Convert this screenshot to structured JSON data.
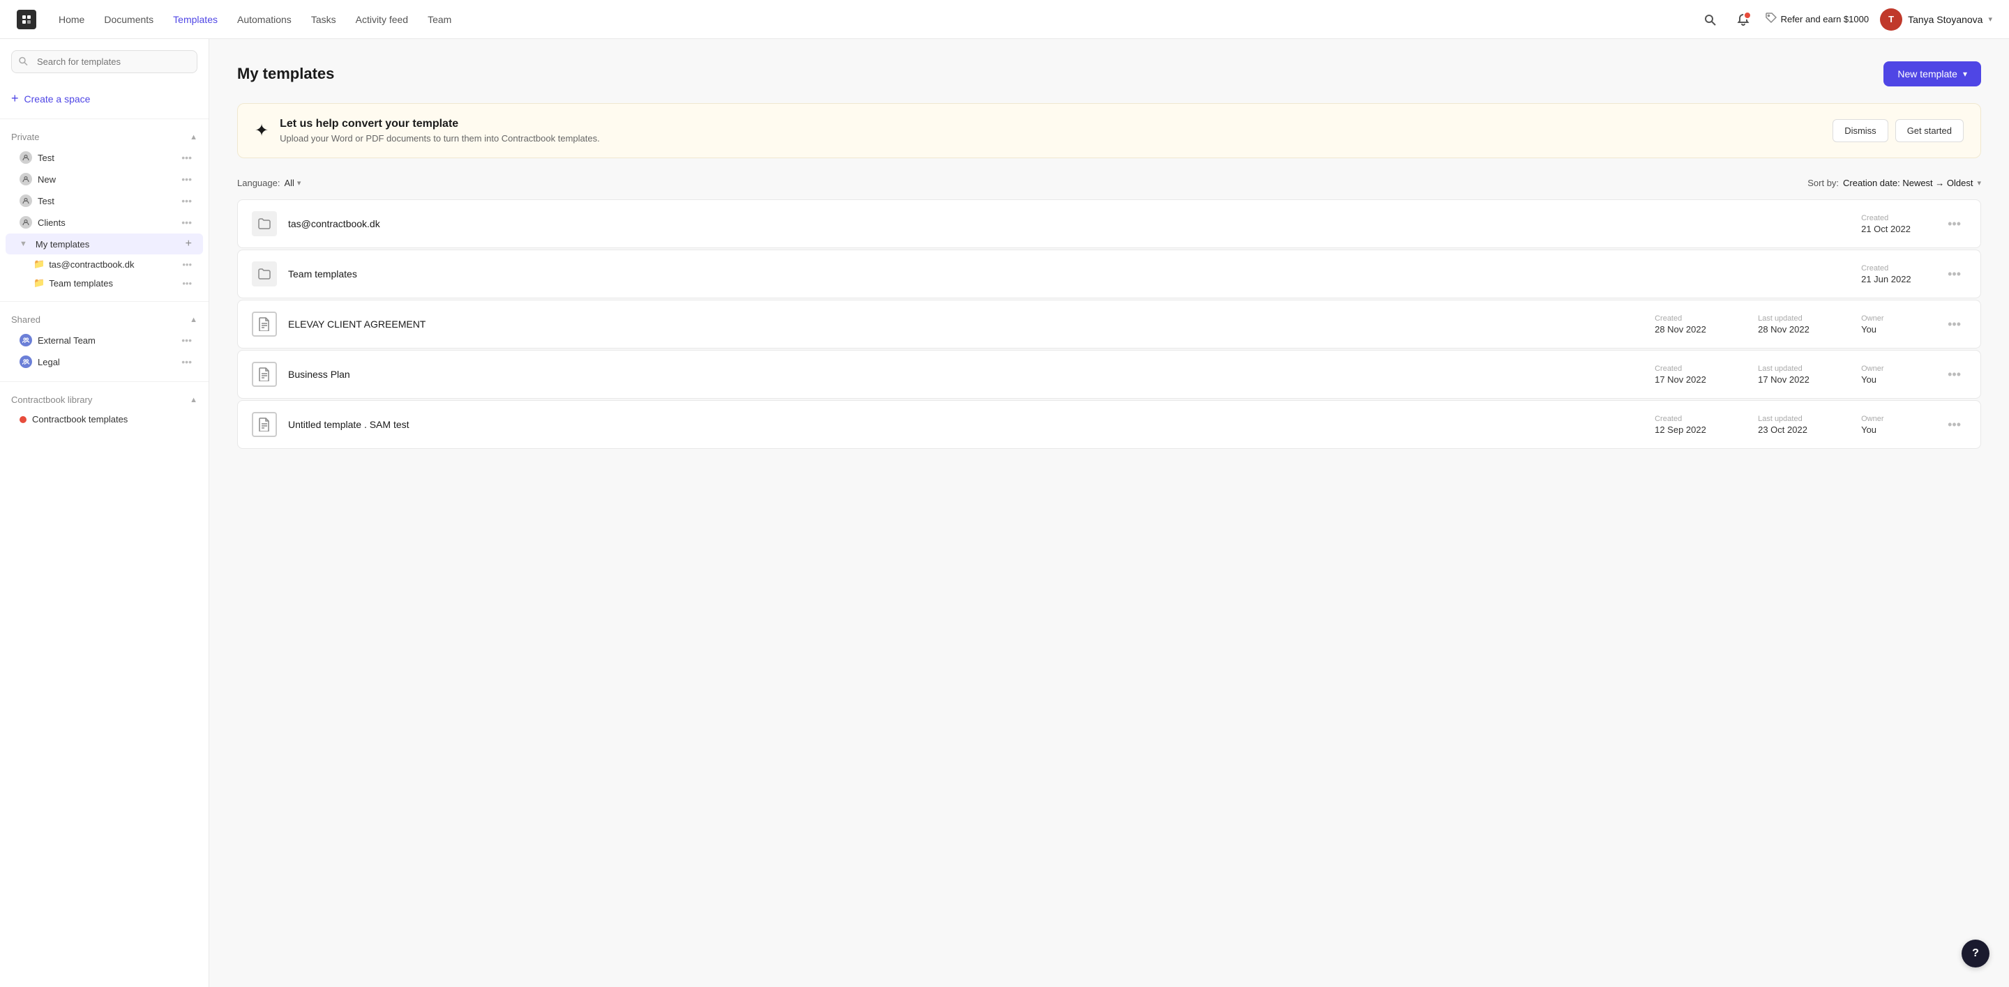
{
  "topnav": {
    "links": [
      {
        "label": "Home",
        "active": false
      },
      {
        "label": "Documents",
        "active": false
      },
      {
        "label": "Templates",
        "active": true
      },
      {
        "label": "Automations",
        "active": false
      },
      {
        "label": "Tasks",
        "active": false
      },
      {
        "label": "Activity feed",
        "active": false
      },
      {
        "label": "Team",
        "active": false
      }
    ],
    "refer_label": "Refer and earn $1000",
    "user_name": "Tanya Stoyanova",
    "user_initials": "T"
  },
  "sidebar": {
    "search_placeholder": "Search for templates",
    "create_label": "Create a space",
    "private": {
      "title": "Private",
      "items": [
        {
          "label": "Test",
          "type": "user"
        },
        {
          "label": "New",
          "type": "user"
        },
        {
          "label": "Test",
          "type": "user"
        },
        {
          "label": "Clients",
          "type": "user"
        }
      ]
    },
    "my_templates": {
      "label": "My templates",
      "sub_items": [
        {
          "label": "tas@contractbook.dk",
          "type": "folder"
        },
        {
          "label": "Team templates",
          "type": "folder"
        }
      ]
    },
    "shared": {
      "title": "Shared",
      "items": [
        {
          "label": "External Team",
          "type": "group"
        },
        {
          "label": "Legal",
          "type": "group"
        }
      ]
    },
    "library": {
      "title": "Contractbook library",
      "items": [
        {
          "label": "Contractbook templates",
          "type": "dot"
        }
      ]
    }
  },
  "main": {
    "title": "My templates",
    "new_template_label": "New template",
    "banner": {
      "icon": "✦",
      "title": "Let us help convert your template",
      "description": "Upload your Word or PDF documents to turn them into Contractbook templates.",
      "dismiss_label": "Dismiss",
      "get_started_label": "Get started"
    },
    "filter": {
      "language_label": "Language:",
      "language_value": "All",
      "sort_label": "Sort by:",
      "sort_value": "Creation date: Newest → Oldest"
    },
    "templates": [
      {
        "type": "folder",
        "name": "tas@contractbook.dk",
        "created": "21 Oct 2022",
        "created_label": "Created",
        "has_owner": false
      },
      {
        "type": "folder",
        "name": "Team templates",
        "created": "21 Jun 2022",
        "created_label": "Created",
        "has_owner": false
      },
      {
        "type": "document",
        "name": "ELEVAY CLIENT AGREEMENT",
        "created": "28 Nov 2022",
        "created_label": "Created",
        "last_updated": "28 Nov 2022",
        "last_updated_label": "Last updated",
        "owner": "You",
        "owner_label": "Owner",
        "has_owner": true
      },
      {
        "type": "document",
        "name": "Business Plan",
        "created": "17 Nov 2022",
        "created_label": "Created",
        "last_updated": "17 Nov 2022",
        "last_updated_label": "Last updated",
        "owner": "You",
        "owner_label": "Owner",
        "has_owner": true
      },
      {
        "type": "document",
        "name": "Untitled template . SAM test",
        "created": "12 Sep 2022",
        "created_label": "Created",
        "last_updated": "23 Oct 2022",
        "last_updated_label": "Last updated",
        "owner": "You",
        "owner_label": "Owner",
        "has_owner": true
      }
    ]
  },
  "help_label": "?"
}
